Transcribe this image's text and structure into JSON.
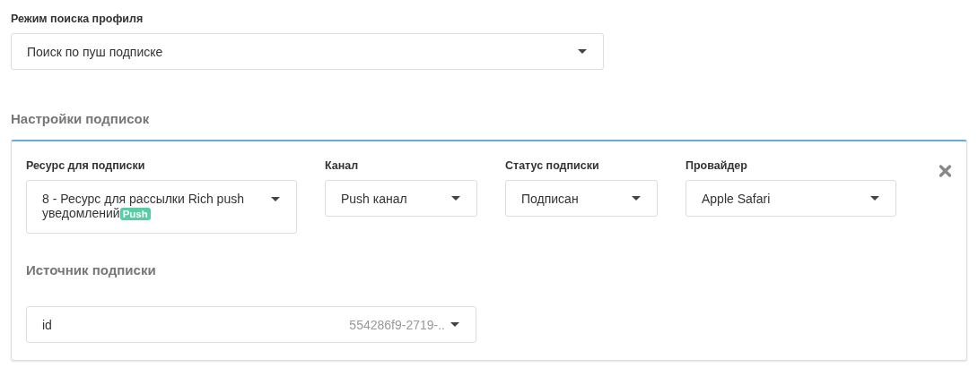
{
  "search_mode": {
    "label": "Режим поиска профиля",
    "value": "Поиск по пуш подписке"
  },
  "subscriptions": {
    "title": "Настройки подписок",
    "fields": [
      {
        "label": "Ресурс для подписки",
        "value": "8 - Ресурс для рассылки Rich push уведомлений",
        "badge": "Push"
      },
      {
        "label": "Канал",
        "value": "Push канал"
      },
      {
        "label": "Статус подписки",
        "value": "Подписан"
      },
      {
        "label": "Провайдер",
        "value": "Apple Safari"
      }
    ],
    "source": {
      "title": "Источник подписки",
      "key": "id",
      "value": "554286f9-2719-.."
    }
  }
}
